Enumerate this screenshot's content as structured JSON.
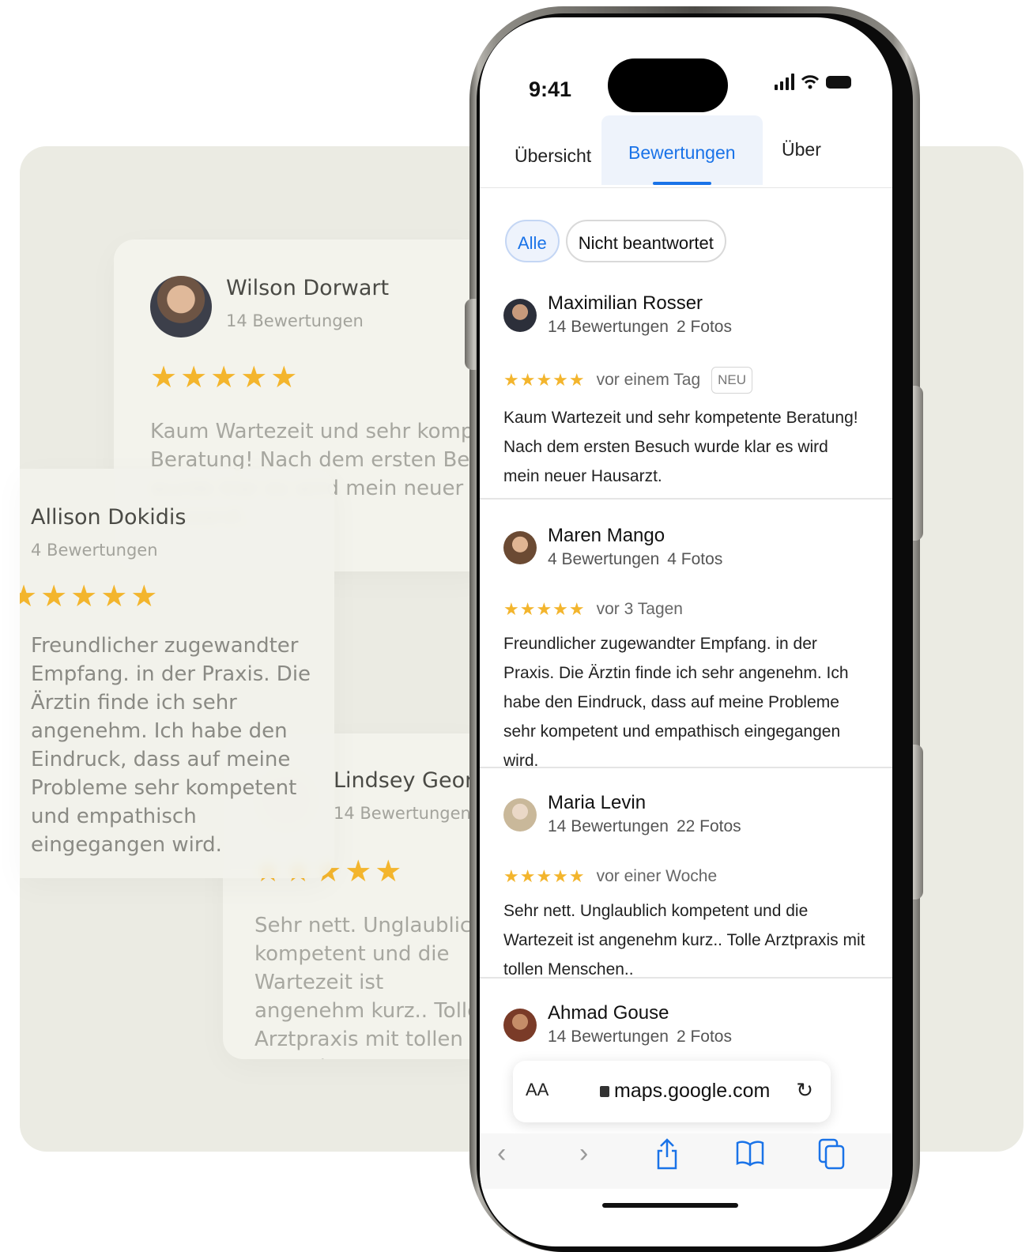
{
  "background_cards": {
    "wilson": {
      "name": "Wilson Dorwart",
      "count": "14 Bewertungen",
      "stars": "★★★★★",
      "text": "Kaum Wartezeit und sehr kompetente Beratung! Nach dem ersten Besuch wurde klar es wird mein neuer Hausarzt."
    },
    "allison": {
      "name": "Allison Dokidis",
      "count": "4 Bewertungen",
      "stars": "★★★★★",
      "text": "Freundlicher zugewandter Empfang. in der Praxis. Die Ärztin finde ich sehr angenehm. Ich habe den Eindruck, dass auf meine Probleme sehr kompetent und empathisch eingegangen wird."
    },
    "lindsey": {
      "name": "Lindsey Georges",
      "count": "14 Bewertungen",
      "stars": "★★★★★",
      "text": "Sehr nett. Unglaublich kompetent und die Wartezeit ist angenehm kurz.. Tolle Arztpraxis mit tollen Menschen.."
    }
  },
  "phone": {
    "status_time": "9:41",
    "tabs": [
      "Übersicht",
      "Bewertungen",
      "Über"
    ],
    "active_tab": "Bewertungen",
    "filters": {
      "all": "Alle",
      "unanswered": "Nicht beantwortet"
    },
    "reviews": [
      {
        "name": "Maximilian Rosser",
        "reviews": "14 Bewertungen",
        "photos": "2 Fotos",
        "stars": "★★★★★",
        "date": "vor einem Tag",
        "badge": "NEU",
        "text": "Kaum Wartezeit und sehr kompetente Beratung! Nach dem ersten Besuch wurde klar es wird mein neuer Hausarzt."
      },
      {
        "name": "Maren Mango",
        "reviews": "4 Bewertungen",
        "photos": "4 Fotos",
        "stars": "★★★★★",
        "date": "vor 3 Tagen",
        "text": "Freundlicher zugewandter Empfang. in der Praxis. Die Ärztin finde ich sehr angenehm. Ich habe den Eindruck, dass auf meine Probleme sehr kompetent und empathisch eingegangen wird."
      },
      {
        "name": "Maria Levin",
        "reviews": "14 Bewertungen",
        "photos": "22 Fotos",
        "stars": "★★★★★",
        "date": "vor einer Woche",
        "text": "Sehr nett. Unglaublich kompetent und die Wartezeit ist angenehm kurz.. Tolle Arztpraxis mit tollen Menschen.."
      },
      {
        "name": "Ahmad Gouse",
        "reviews": "14 Bewertungen",
        "photos": "2 Fotos"
      }
    ],
    "url_bar": {
      "text_size": "AA",
      "url": "maps.google.com"
    },
    "colors": {
      "accent": "#1a73e8",
      "star": "#f3b52d",
      "panel": "#ebebe3"
    },
    "icons": [
      "back-icon",
      "forward-icon",
      "share-icon",
      "bookmarks-icon",
      "tabs-icon"
    ]
  }
}
